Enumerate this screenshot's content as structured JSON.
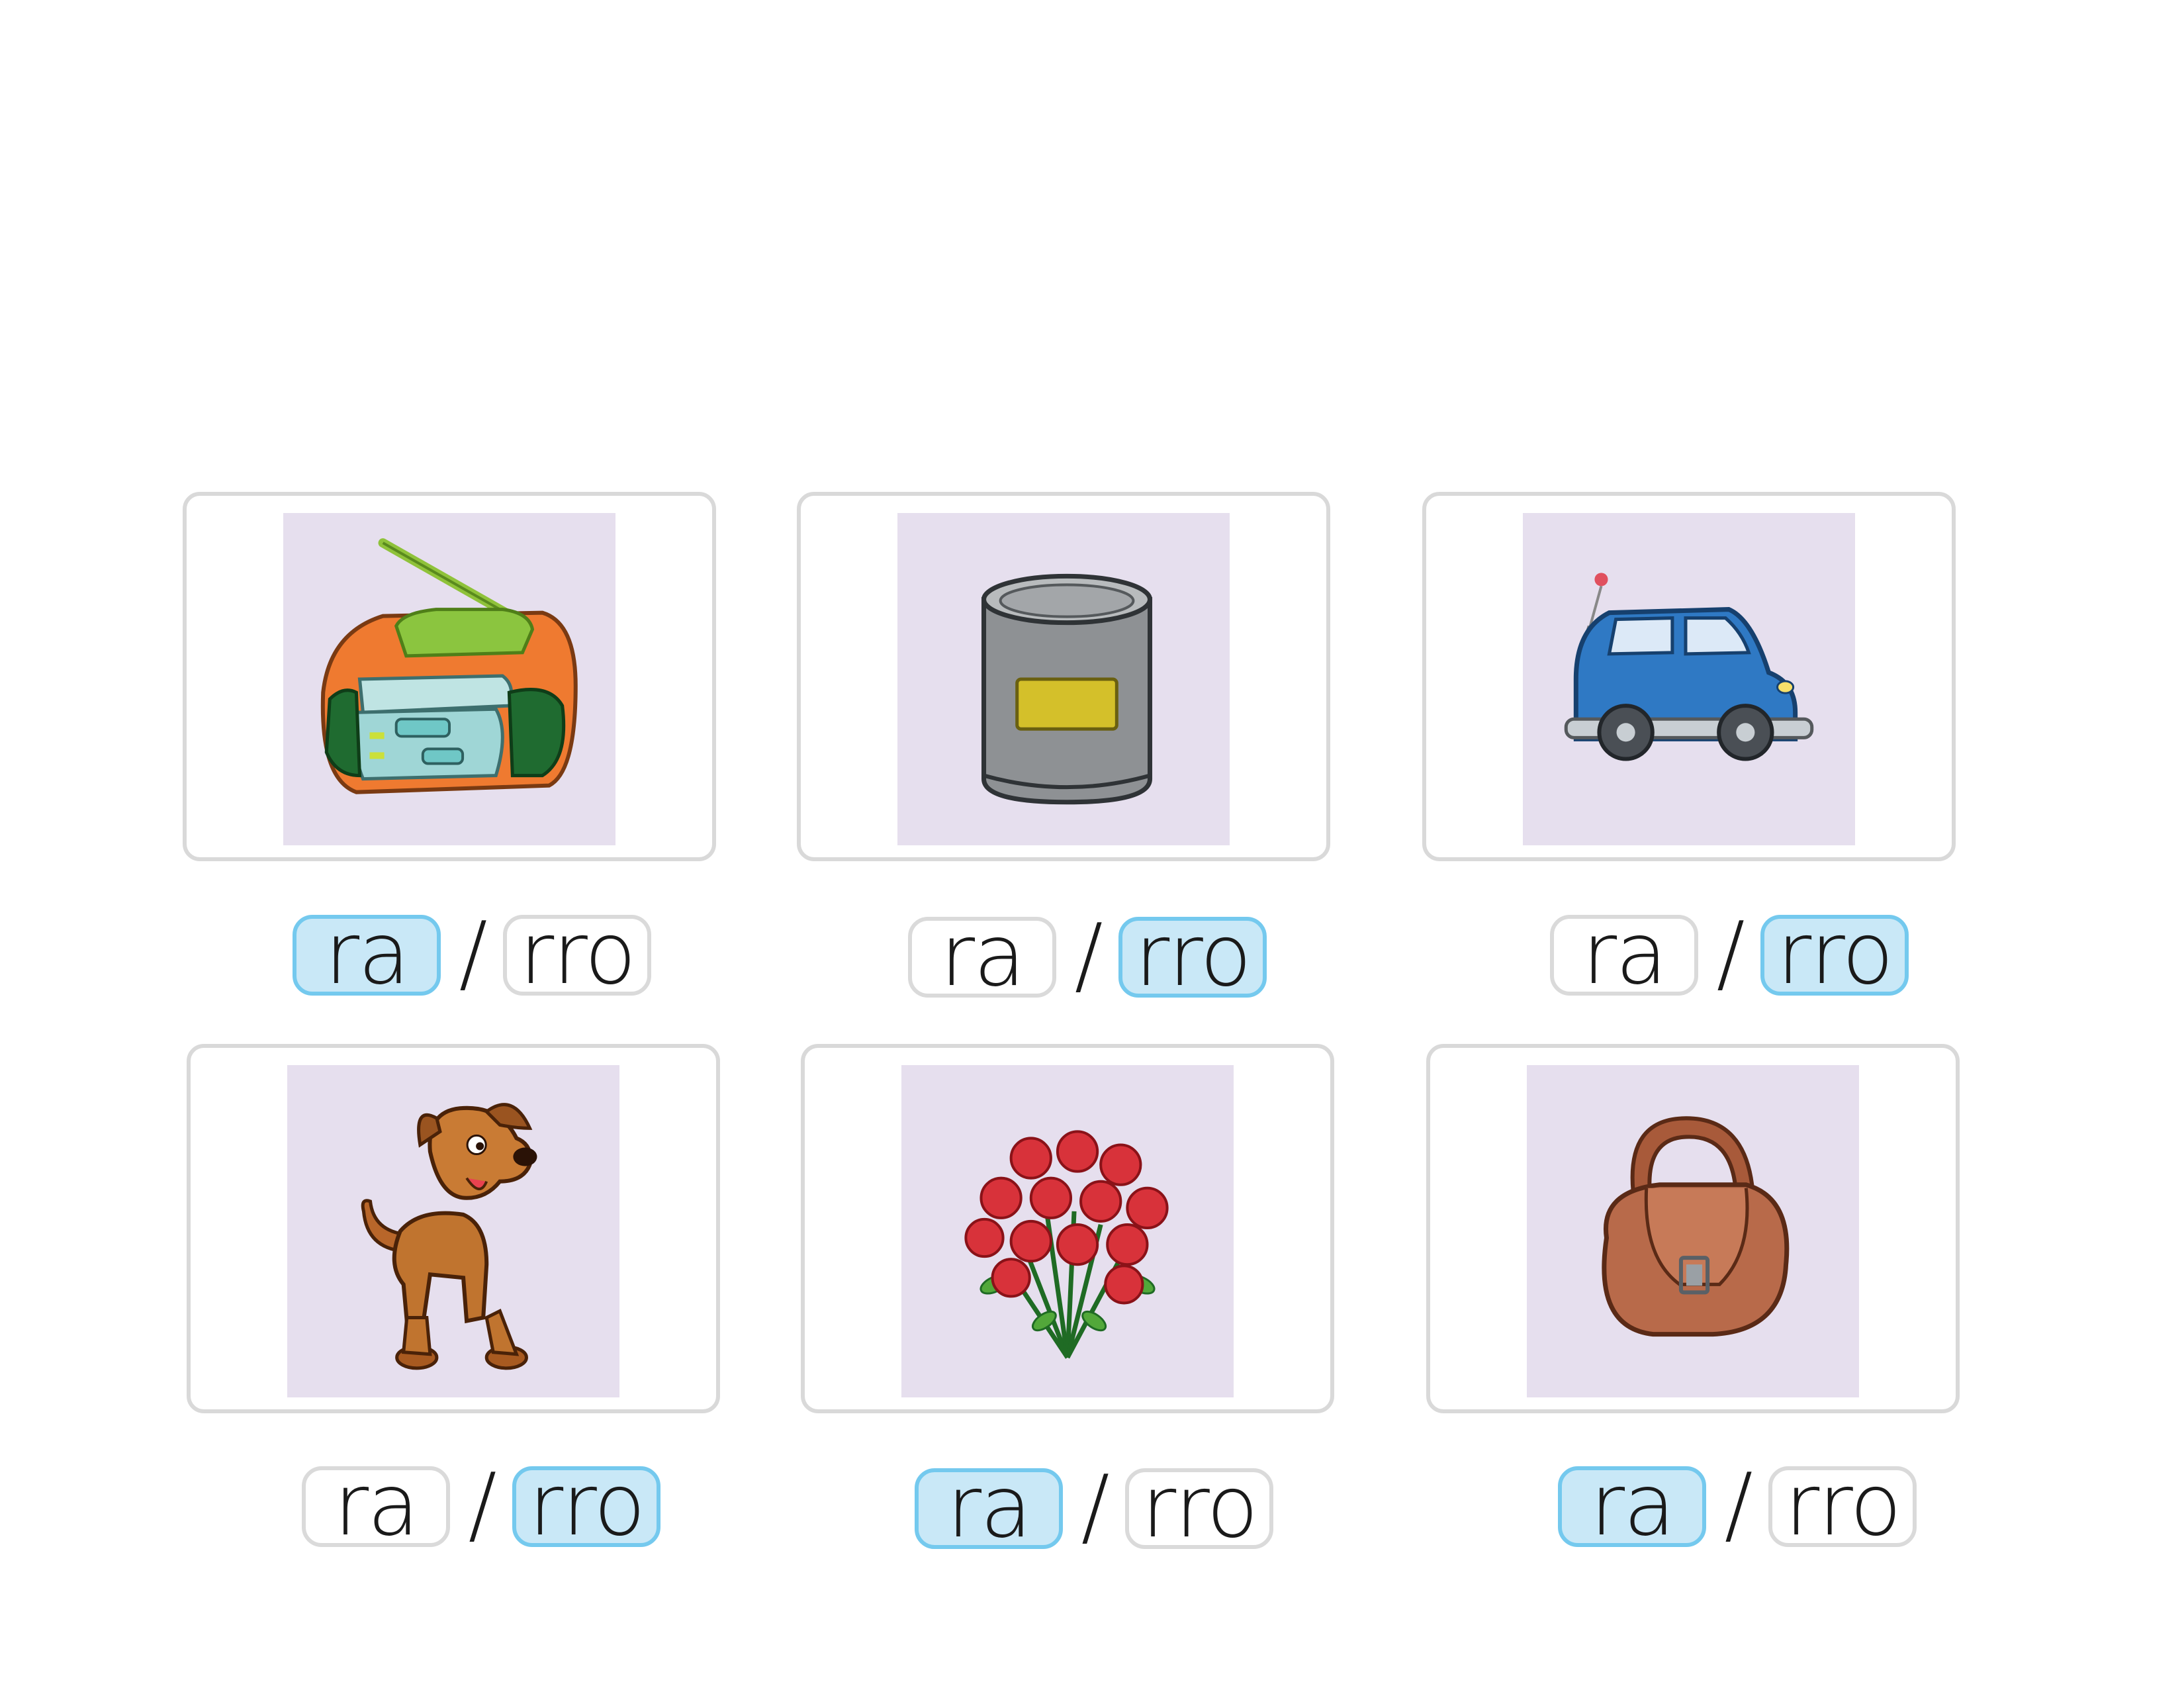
{
  "items": [
    {
      "picture": "radio",
      "options": [
        "ra",
        "rro"
      ],
      "selected": 0
    },
    {
      "picture": "can",
      "options": [
        "ra",
        "rro"
      ],
      "selected": 1
    },
    {
      "picture": "car",
      "options": [
        "ra",
        "rro"
      ],
      "selected": 1
    },
    {
      "picture": "dog",
      "options": [
        "ra",
        "rro"
      ],
      "selected": 1
    },
    {
      "picture": "roses",
      "options": [
        "ra",
        "rro"
      ],
      "selected": 0
    },
    {
      "picture": "bag",
      "options": [
        "ra",
        "rro"
      ],
      "selected": 0
    }
  ],
  "separator": "/",
  "colors": {
    "picture_background": "#e6dfee",
    "selected_fill": "#c9e8f7",
    "selected_border": "#74c9ee",
    "card_border": "#d9d9d9"
  }
}
